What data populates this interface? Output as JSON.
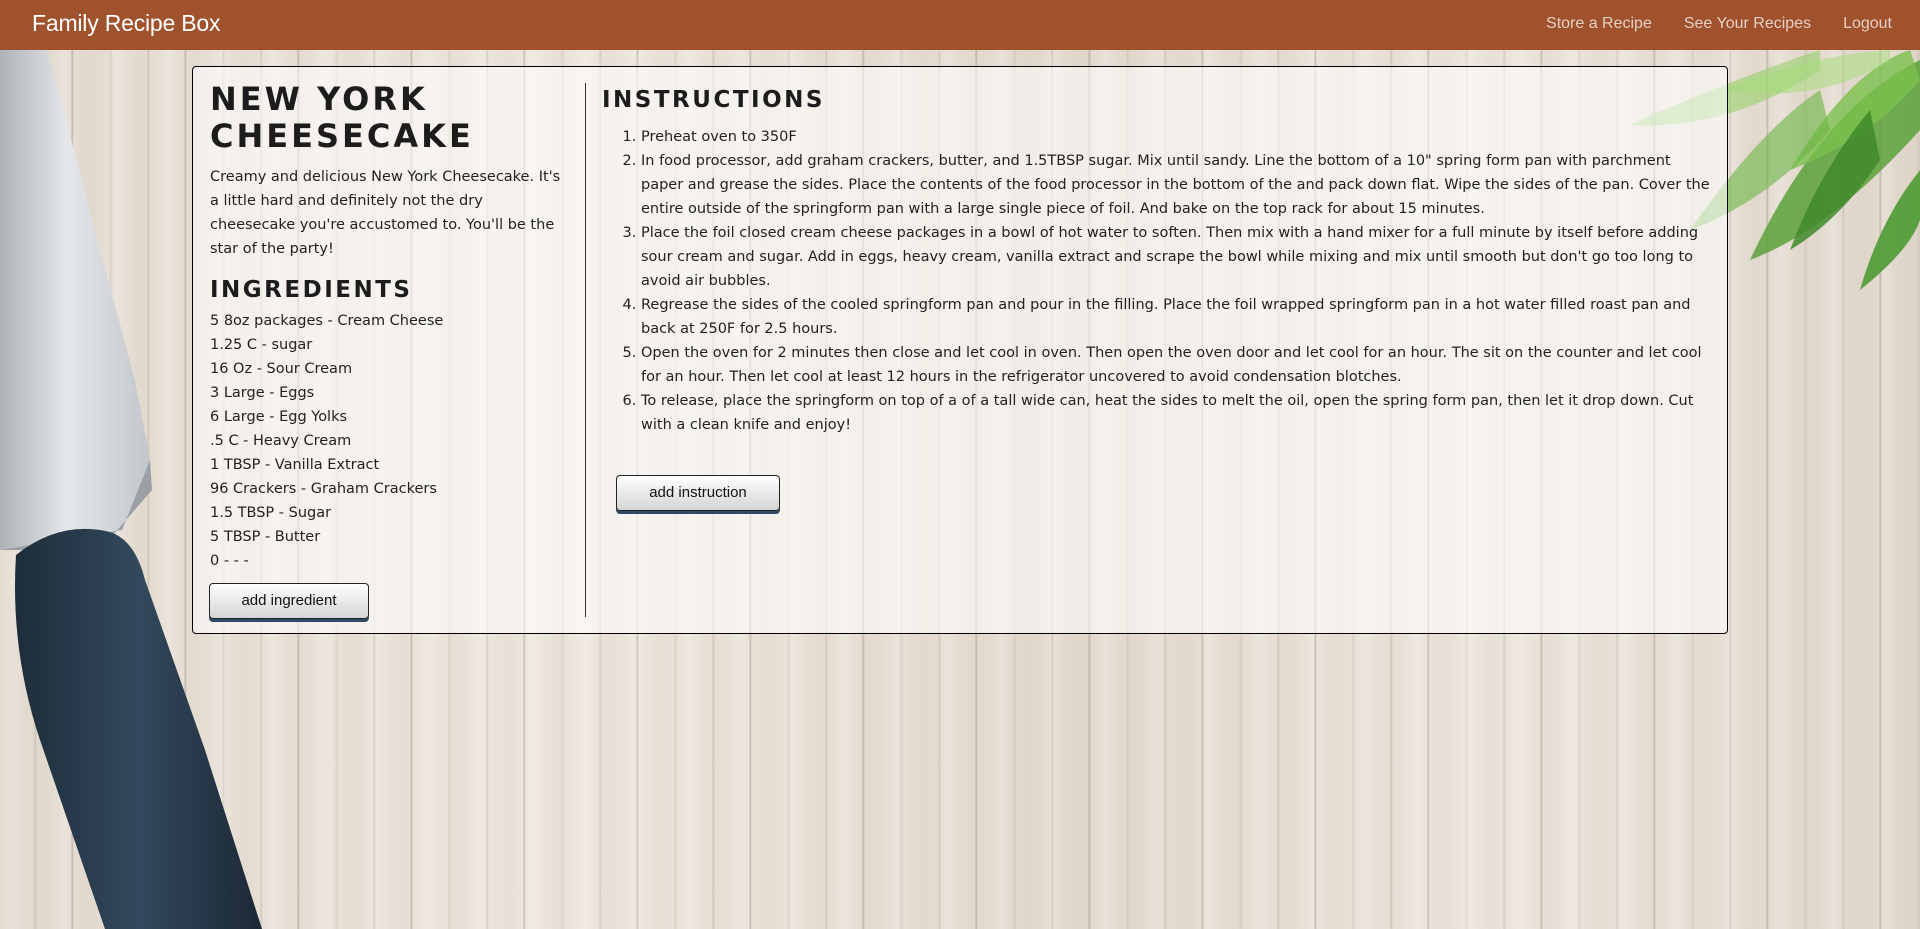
{
  "nav": {
    "brand": "Family Recipe Box",
    "links": [
      "Store a Recipe",
      "See Your Recipes",
      "Logout"
    ]
  },
  "recipe": {
    "title": "New York Cheesecake",
    "description": "Creamy and delicious New York Cheesecake. It's a little hard and definitely not the dry cheesecake you're accustomed to. You'll be the star of the party!",
    "ingredients_heading": "Ingredients",
    "ingredients": [
      "5 8oz packages - Cream Cheese",
      "1.25 C - sugar",
      "16 Oz - Sour Cream",
      "3 Large - Eggs",
      "6 Large - Egg Yolks",
      ".5 C - Heavy Cream",
      "1 TBSP - Vanilla Extract",
      "96 Crackers - Graham Crackers",
      "1.5 TBSP - Sugar",
      "5 TBSP - Butter",
      "0 - - -"
    ],
    "add_ingredient_label": "add ingredient",
    "instructions_heading": "Instructions",
    "instructions": [
      "Preheat oven to 350F",
      "In food processor, add graham crackers, butter, and 1.5TBSP sugar. Mix until sandy. Line the bottom of a 10\" spring form pan with parchment paper and grease the sides. Place the contents of the food processor in the bottom of the and pack down flat. Wipe the sides of the pan. Cover the entire outside of the springform pan with a large single piece of foil. And bake on the top rack for about 15 minutes.",
      "Place the foil closed cream cheese packages in a bowl of hot water to soften. Then mix with a hand mixer for a full minute by itself before adding sour cream and sugar. Add in eggs, heavy cream, vanilla extract and scrape the bowl while mixing and mix until smooth but don't go too long to avoid air bubbles.",
      "Regrease the sides of the cooled springform pan and pour in the filling. Place the foil wrapped springform pan in a hot water filled roast pan and back at 250F for 2.5 hours.",
      "Open the oven for 2 minutes then close and let cool in oven. Then open the oven door and let cool for an hour. The sit on the counter and let cool for an hour. Then let cool at least 12 hours in the refrigerator uncovered to avoid condensation blotches.",
      "To release, place the springform on top of a of a tall wide can, heat the sides to melt the oil, open the spring form pan, then let it drop down. Cut with a clean knife and enjoy!"
    ],
    "add_instruction_label": "add instruction"
  },
  "colors": {
    "navbar": "#a0522d",
    "button_shadow": "#2d4a66"
  },
  "icons": [
    "knife-decoration",
    "greens-decoration"
  ]
}
